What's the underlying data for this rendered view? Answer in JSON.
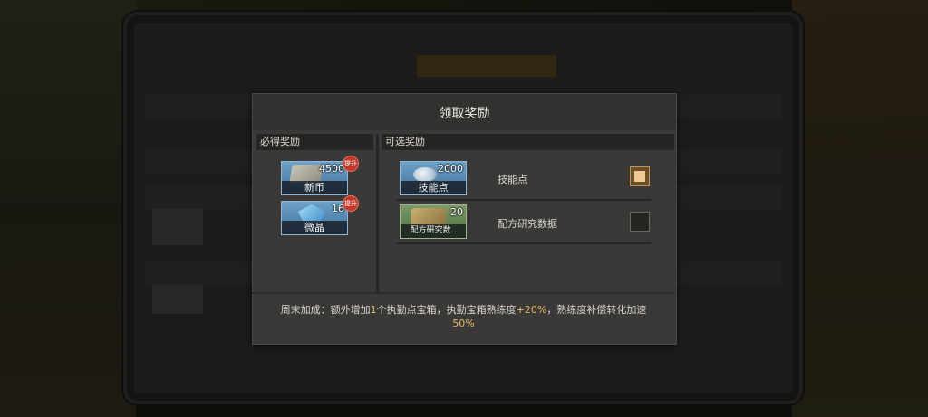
{
  "dialog": {
    "title": "领取奖励",
    "guaranteed_section": "必得奖励",
    "optional_section": "可选奖励",
    "guaranteed_items": [
      {
        "name": "新币",
        "count": "4500",
        "badge": "提升",
        "icon": "cash-icon"
      },
      {
        "name": "微晶",
        "count": "16",
        "badge": "提升",
        "icon": "crystal-icon"
      }
    ],
    "optional_items": [
      {
        "name": "技能点",
        "count": "2000",
        "option_label": "技能点",
        "checked": true,
        "icon": "skill-point-icon"
      },
      {
        "name": "配方研究数..",
        "count": "20",
        "option_label": "配方研究数据",
        "checked": false,
        "icon": "recipe-data-icon"
      }
    ],
    "footer": {
      "part1": "周末加成：额外增加",
      "num1": "1",
      "part2": "个执勤点宝箱，执勤宝箱熟练度",
      "num2": "+20%",
      "part3": "，熟练度补偿转化加速",
      "num3": "50%"
    }
  },
  "colors": {
    "accent": "#e6b86a",
    "badge": "#c0392b",
    "card_blue": "#4f82ac",
    "card_green": "#5e7a4a"
  }
}
